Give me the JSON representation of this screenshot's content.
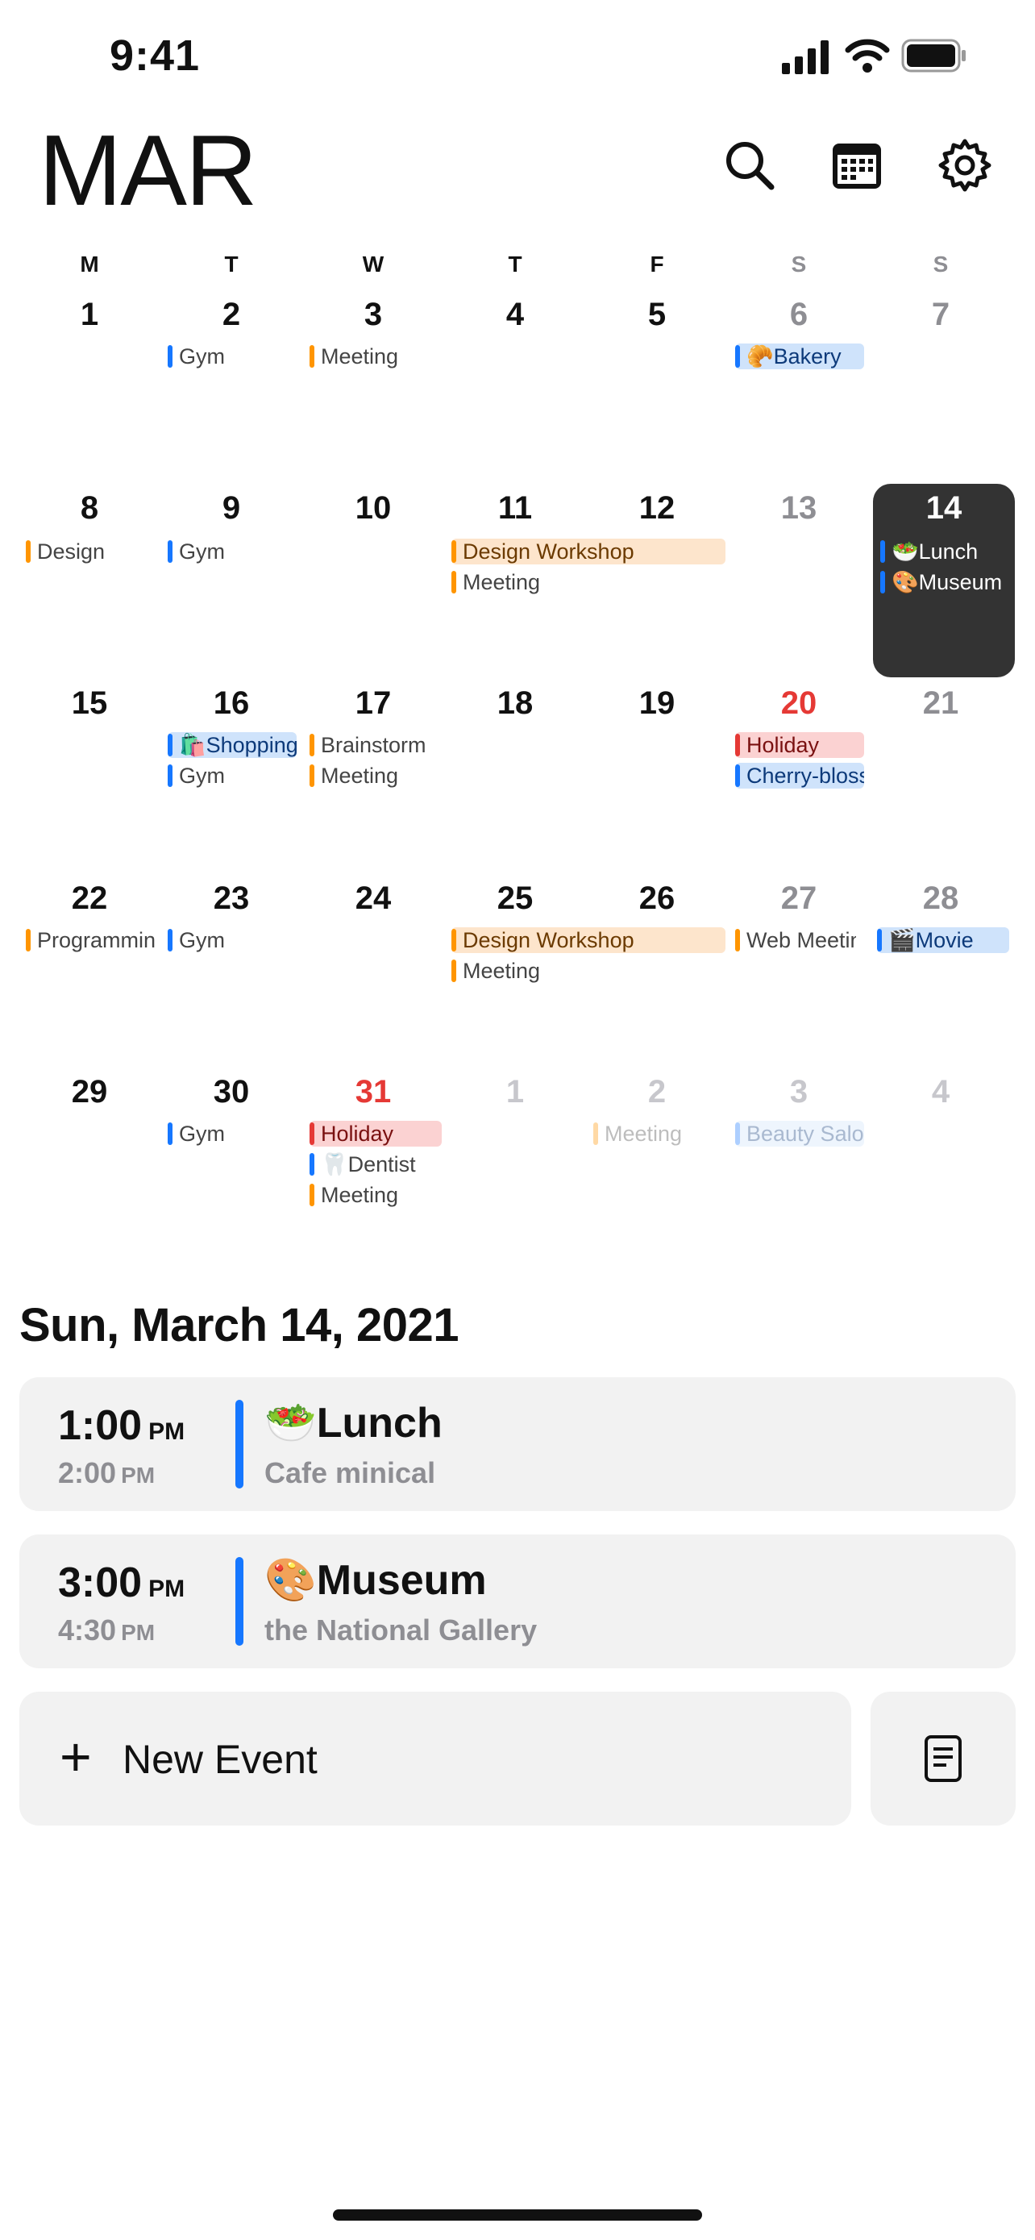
{
  "status_bar": {
    "time": "9:41"
  },
  "header": {
    "month": "MAR",
    "icons": [
      "search-icon",
      "calendar-icon",
      "gear-icon"
    ]
  },
  "weekdays": [
    "M",
    "T",
    "W",
    "T",
    "F",
    "S",
    "S"
  ],
  "weeks": [
    {
      "days": [
        "1",
        "2",
        "3",
        "4",
        "5",
        "6",
        "7"
      ]
    },
    {
      "days": [
        "8",
        "9",
        "10",
        "11",
        "12",
        "13",
        "14"
      ]
    },
    {
      "days": [
        "15",
        "16",
        "17",
        "18",
        "19",
        "20",
        "21"
      ]
    },
    {
      "days": [
        "22",
        "23",
        "24",
        "25",
        "26",
        "27",
        "28"
      ]
    },
    {
      "days": [
        "29",
        "30",
        "31",
        "1",
        "2",
        "3",
        "4"
      ]
    }
  ],
  "events": {
    "w1": {
      "gym": "Gym",
      "meeting": "Meeting",
      "bakery": "🥐Bakery"
    },
    "w2": {
      "design": "Design",
      "gym": "Gym",
      "workshop": "Design Workshop",
      "meeting": "Meeting",
      "lunch": "🥗Lunch",
      "museum": "🎨Museum"
    },
    "w3": {
      "shopping": "🛍️Shopping",
      "gym": "Gym",
      "brainstorm": "Brainstorm",
      "meeting": "Meeting",
      "holiday": "Holiday",
      "cherry": "Cherry-blossom"
    },
    "w4": {
      "programming": "Programming",
      "gym": "Gym",
      "workshop": "Design Workshop",
      "meeting": "Meeting",
      "webmeet": "Web Meeting",
      "movie": "🎬Movie"
    },
    "w5": {
      "gym": "Gym",
      "holiday": "Holiday",
      "dentist": "🦷Dentist",
      "meeting": "Meeting",
      "meeting2": "Meeting",
      "beauty": "Beauty Salon"
    }
  },
  "selected_date": "Sun, March 14, 2021",
  "agenda": [
    {
      "start": "1:00",
      "start_ampm": "PM",
      "end": "2:00",
      "end_ampm": "PM",
      "title": "🥗Lunch",
      "location": "Cafe minical",
      "color": "#1677ff"
    },
    {
      "start": "3:00",
      "start_ampm": "PM",
      "end": "4:30",
      "end_ampm": "PM",
      "title": "🎨Museum",
      "location": "the National Gallery",
      "color": "#1677ff"
    }
  ],
  "actions": {
    "new_event": "New Event",
    "notes_icon": "note-icon"
  }
}
